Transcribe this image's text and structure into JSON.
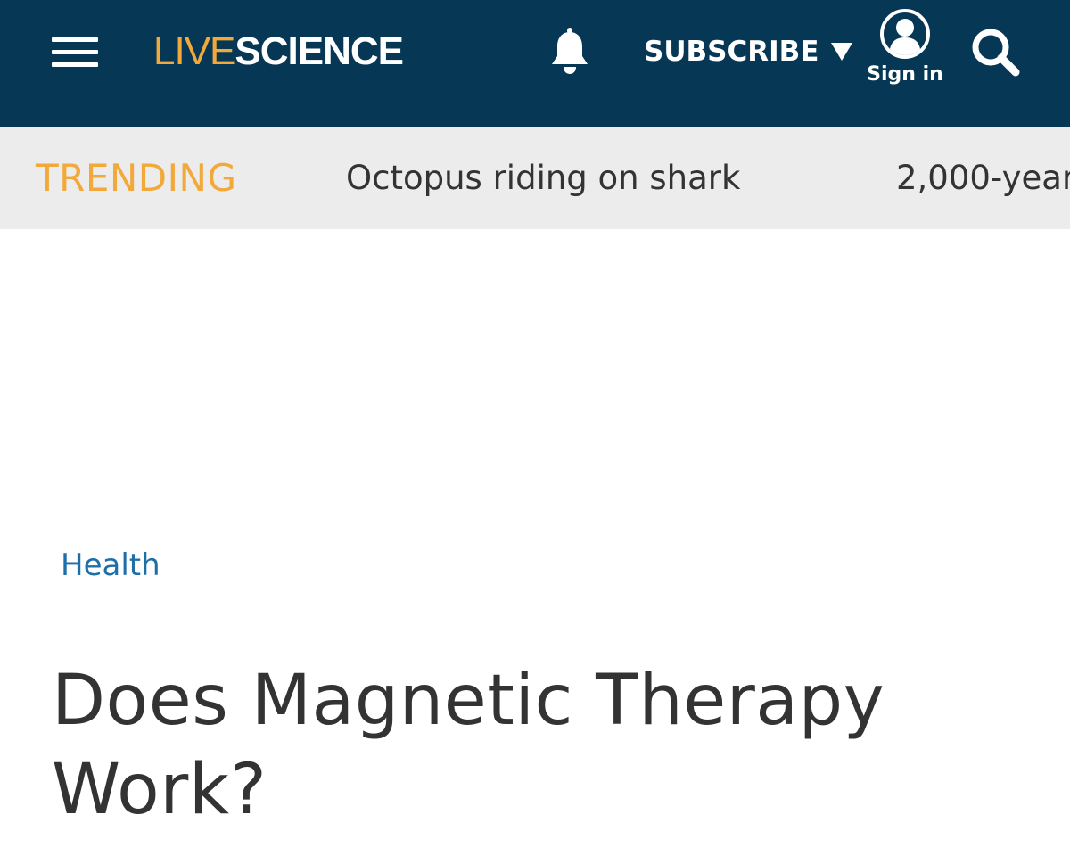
{
  "header": {
    "logo": {
      "part1": "LIVE",
      "part2": "SCIENCE"
    },
    "menu_icon": "hamburger-menu-icon",
    "bell_icon": "bell-icon",
    "subscribe_label": "SUBSCRIBE",
    "signin_label": "Sign in",
    "search_icon": "search-icon",
    "colors": {
      "background": "#063755",
      "accent": "#f3a83a",
      "text": "#ffffff"
    }
  },
  "trending": {
    "label": "TRENDING",
    "items": [
      "Octopus riding on shark",
      "2,000-year"
    ],
    "colors": {
      "background": "#ececec",
      "label": "#f3a83a",
      "text": "#333333"
    }
  },
  "article": {
    "category": "Health",
    "title": "Does Magnetic Therapy Work?",
    "colors": {
      "category": "#1f6ea8",
      "title": "#333333"
    }
  }
}
